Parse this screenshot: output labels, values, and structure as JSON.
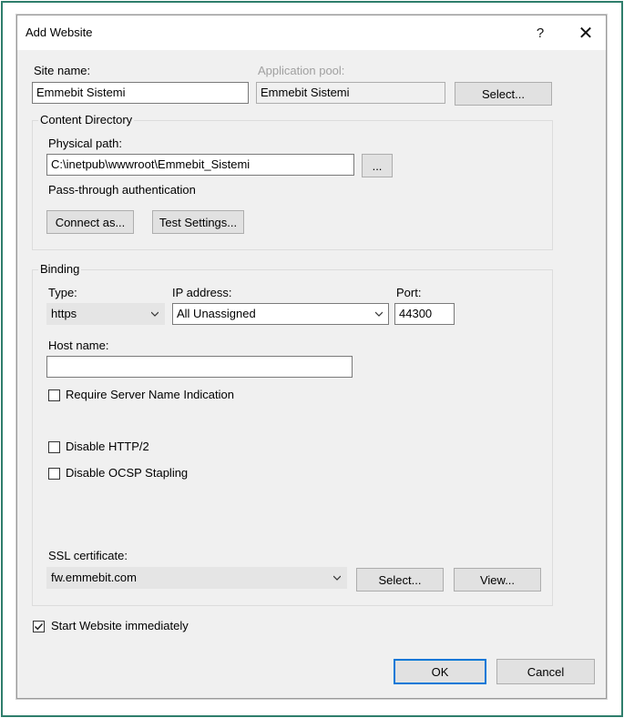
{
  "dialog": {
    "title": "Add Website",
    "help_glyph": "?",
    "close_glyph": "✕"
  },
  "site": {
    "site_name_label": "Site name:",
    "site_name_value": "Emmebit Sistemi",
    "app_pool_label": "Application pool:",
    "app_pool_value": "Emmebit Sistemi",
    "select_label": "Select..."
  },
  "content_directory": {
    "group_title": "Content Directory",
    "physical_path_label": "Physical path:",
    "physical_path_value": "C:\\inetpub\\wwwroot\\Emmebit_Sistemi",
    "browse_label": "...",
    "passthrough_label": "Pass-through authentication",
    "connect_as_label": "Connect as...",
    "test_settings_label": "Test Settings..."
  },
  "binding": {
    "group_title": "Binding",
    "type_label": "Type:",
    "type_value": "https",
    "ip_label": "IP address:",
    "ip_value": "All Unassigned",
    "port_label": "Port:",
    "port_value": "44300",
    "host_name_label": "Host name:",
    "host_name_value": "",
    "sni_label": "Require Server Name Indication",
    "sni_checked": false,
    "disable_http2_label": "Disable HTTP/2",
    "disable_http2_checked": false,
    "disable_ocsp_label": "Disable OCSP Stapling",
    "disable_ocsp_checked": false,
    "ssl_label": "SSL certificate:",
    "ssl_value": "fw.emmebit.com",
    "ssl_select_label": "Select...",
    "ssl_view_label": "View..."
  },
  "footer": {
    "start_label": "Start Website immediately",
    "start_checked": true,
    "ok_label": "OK",
    "cancel_label": "Cancel"
  },
  "colors": {
    "frame_border": "#2e7d6b",
    "dialog_bg": "#f0f0f0",
    "default_button_border": "#0078d7"
  }
}
